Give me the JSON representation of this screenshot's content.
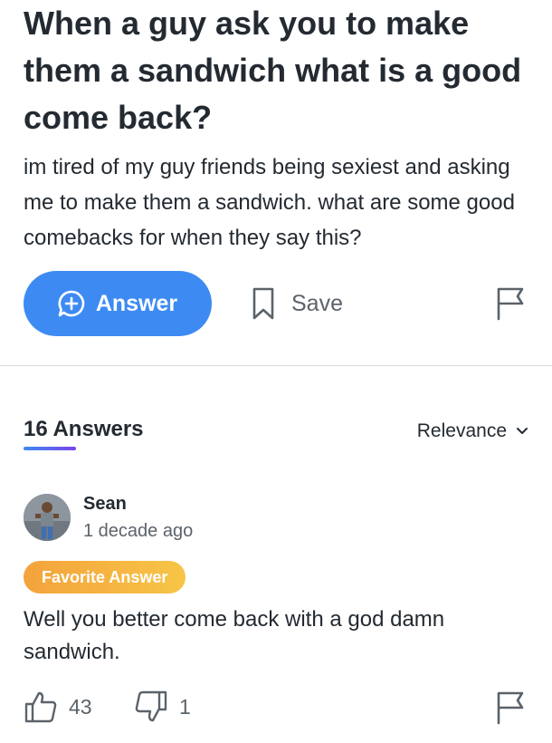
{
  "question": {
    "title": "When a guy ask you to make them a sandwich what is a good come back?",
    "body": "im tired of my guy friends being sexiest and asking me to make them a sandwich. what are some good comebacks for when they say this?"
  },
  "actions": {
    "answer_label": "Answer",
    "save_label": "Save"
  },
  "answers_header": {
    "count_label": "16 Answers",
    "sort_label": "Relevance"
  },
  "answer": {
    "author": "Sean",
    "timestamp": "1 decade ago",
    "badge": "Favorite Answer",
    "text": "Well you better come back with a god damn sandwich.",
    "upvotes": "43",
    "downvotes": "1"
  },
  "colors": {
    "accent": "#3d8bf2",
    "badge_start": "#f3a33c",
    "badge_end": "#f7c547",
    "text": "#232a31",
    "muted": "#5b636a"
  },
  "icons": {
    "answer": "plus-speech-bubble-icon",
    "save": "bookmark-icon",
    "report": "flag-icon",
    "sort": "chevron-down-icon",
    "upvote": "thumbs-up-icon",
    "downvote": "thumbs-down-icon"
  }
}
